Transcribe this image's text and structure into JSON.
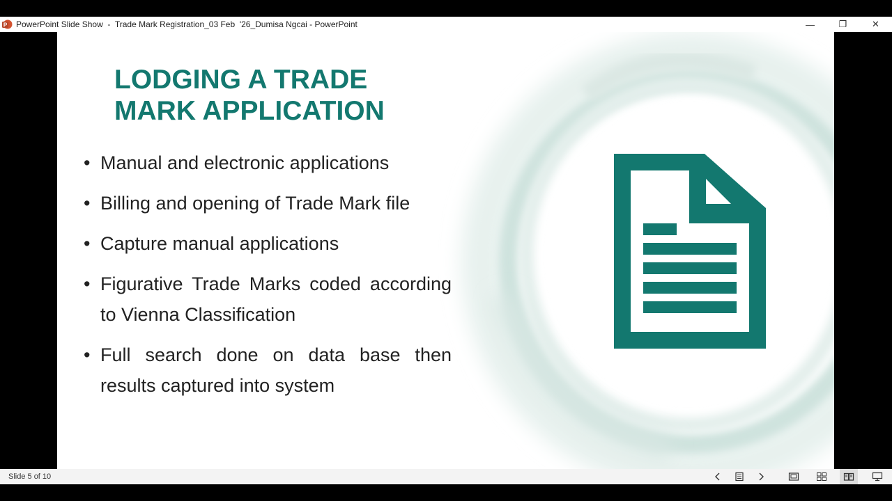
{
  "window": {
    "title": "PowerPoint Slide Show  -  Trade Mark Registration_03 Feb  '26_Dumisa Ngcai - PowerPoint",
    "minimize": "—",
    "restore": "❐",
    "close": "✕"
  },
  "slide": {
    "title": "LODGING A TRADE\nMARK APPLICATION",
    "bullets": [
      " Manual and electronic applications",
      " Billing and opening of Trade Mark file",
      "Capture manual applications",
      "Figurative Trade Marks coded according to Vienna Classification",
      "Full search done on data base then results captured into system"
    ],
    "icon": "document-icon",
    "accent_color": "#13786f"
  },
  "status": {
    "slide_indicator": "Slide 5 of 10",
    "icons": [
      "previous-slide-icon",
      "slide-menu-icon",
      "next-slide-icon",
      "normal-view-icon",
      "slide-sorter-icon",
      "reading-view-icon",
      "slide-show-icon"
    ]
  }
}
